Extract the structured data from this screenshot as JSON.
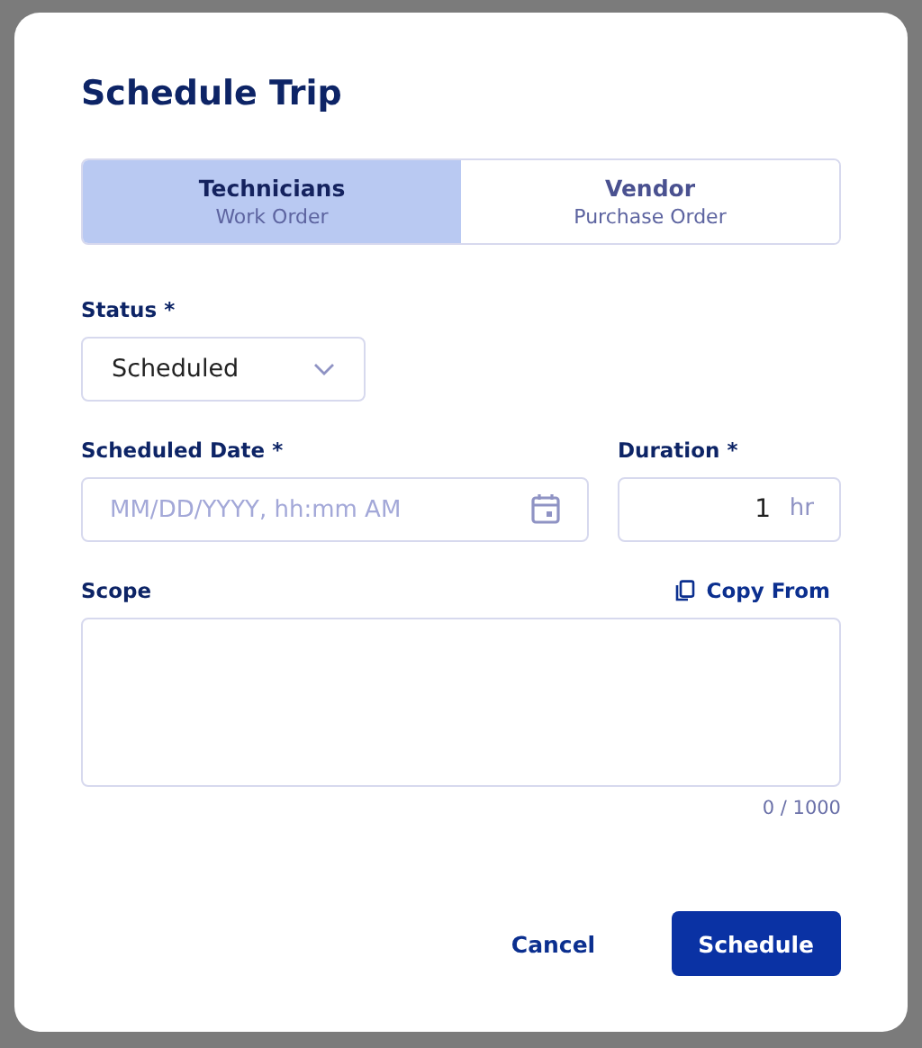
{
  "dialog": {
    "title": "Schedule Trip",
    "tabs": [
      {
        "label": "Technicians",
        "sublabel": "Work Order",
        "selected": true
      },
      {
        "label": "Vendor",
        "sublabel": "Purchase Order",
        "selected": false
      }
    ],
    "status": {
      "label": "Status *",
      "value": "Scheduled"
    },
    "scheduled_date": {
      "label": "Scheduled Date *",
      "placeholder": "MM/DD/YYYY, hh:mm AM"
    },
    "duration": {
      "label": "Duration *",
      "value": "1",
      "unit": "hr"
    },
    "scope": {
      "label": "Scope",
      "copy_from": "Copy From",
      "counter": "0 / 1000"
    },
    "buttons": [
      {
        "label": "Cancel",
        "kind": "secondary"
      },
      {
        "label": "Schedule",
        "kind": "primary"
      }
    ]
  }
}
